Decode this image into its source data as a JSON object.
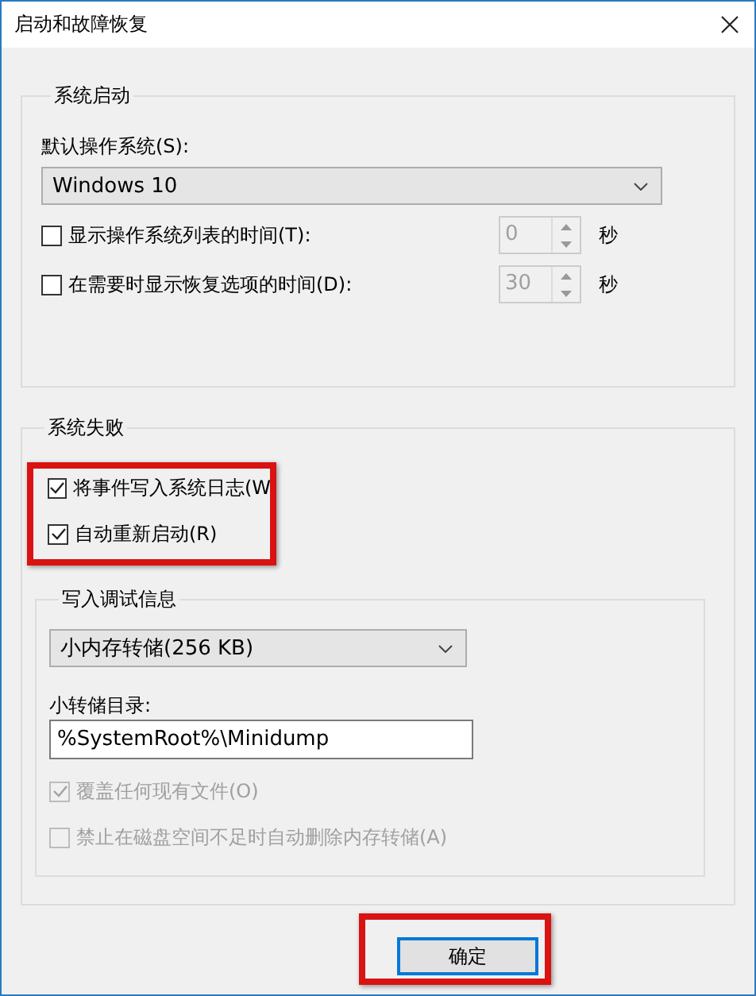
{
  "window": {
    "title": "启动和故障恢复"
  },
  "system_startup": {
    "title": "系统启动",
    "default_os_label": "默认操作系统(S):",
    "default_os": {
      "value": "Windows 10"
    },
    "timers": [
      {
        "label": "显示操作系统列表的时间(T):",
        "checked": false,
        "value": "0",
        "field_disabled": true,
        "unit": "秒"
      },
      {
        "label": "在需要时显示恢复选项的时间(D):",
        "checked": false,
        "value": "30",
        "field_disabled": true,
        "unit": "秒"
      }
    ]
  },
  "system_failure": {
    "title": "系统失败",
    "options_highlighted": true,
    "options": [
      {
        "label": "将事件写入系统日志(W",
        "checked": true,
        "disabled": false
      },
      {
        "label": "自动重新启动(R)",
        "checked": true,
        "disabled": false
      }
    ],
    "debug_info": {
      "title": "写入调试信息",
      "dump_type": {
        "value": "小内存转储(256 KB)"
      },
      "dump_dir_label": "小转储目录:",
      "dump_dir": {
        "value": "%SystemRoot%\\Minidump"
      },
      "options": [
        {
          "label": "覆盖任何现有文件(O)",
          "checked": true,
          "disabled": true
        },
        {
          "label": "禁止在磁盘空间不足时自动删除内存转储(A)",
          "checked": false,
          "disabled": true
        }
      ]
    }
  },
  "buttons": [
    {
      "label": "确定",
      "default": true,
      "highlighted": true
    }
  ]
}
